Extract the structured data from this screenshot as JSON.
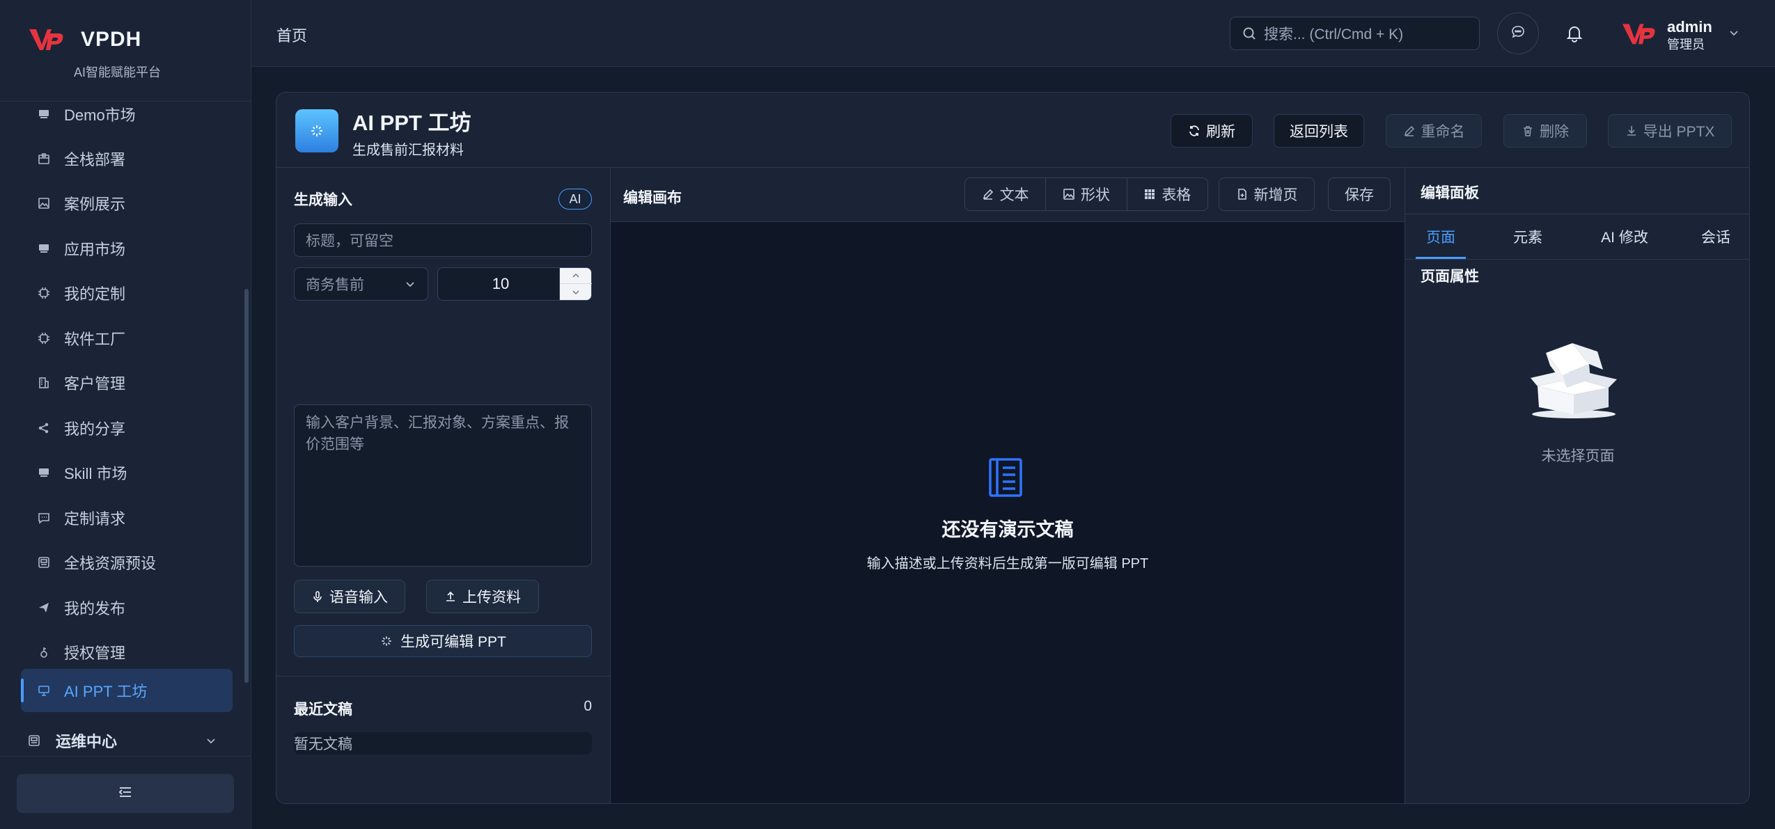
{
  "brand": {
    "name": "VPDH",
    "subtitle": "AI智能赋能平台"
  },
  "sidebar": {
    "items": [
      {
        "label": "Demo市场",
        "icon": "store-icon"
      },
      {
        "label": "全栈部署",
        "icon": "package-icon"
      },
      {
        "label": "案例展示",
        "icon": "image-icon"
      },
      {
        "label": "应用市场",
        "icon": "store-icon"
      },
      {
        "label": "我的定制",
        "icon": "chip-icon"
      },
      {
        "label": "软件工厂",
        "icon": "chip-icon"
      },
      {
        "label": "客户管理",
        "icon": "building-icon"
      },
      {
        "label": "我的分享",
        "icon": "share-icon"
      },
      {
        "label": "Skill 市场",
        "icon": "store-icon"
      },
      {
        "label": "定制请求",
        "icon": "message-icon"
      },
      {
        "label": "全栈资源预设",
        "icon": "preset-icon"
      },
      {
        "label": "我的发布",
        "icon": "send-icon"
      },
      {
        "label": "授权管理",
        "icon": "key-icon"
      },
      {
        "label": "AI PPT 工坊",
        "icon": "presentation-icon",
        "active": true
      }
    ],
    "group": {
      "label": "运维中心",
      "icon": "ops-icon"
    }
  },
  "header": {
    "breadcrumb": "首页",
    "search_placeholder": "搜索... (Ctrl/Cmd + K)",
    "user": {
      "name": "admin",
      "role": "管理员"
    }
  },
  "card": {
    "title": "AI PPT 工坊",
    "subtitle": "生成售前汇报材料",
    "buttons": {
      "refresh": "刷新",
      "back": "返回列表",
      "rename": "重命名",
      "delete": "删除",
      "export": "导出 PPTX"
    }
  },
  "input_panel": {
    "title": "生成输入",
    "badge": "AI",
    "title_placeholder": "标题，可留空",
    "scene_value": "商务售前",
    "page_count": "10",
    "description_placeholder": "输入客户背景、汇报对象、方案重点、报价范围等",
    "voice_button": "语音输入",
    "upload_button": "上传资料",
    "generate_button": "生成可编辑 PPT",
    "recent_title": "最近文稿",
    "recent_count": "0",
    "recent_empty": "暂无文稿"
  },
  "canvas": {
    "title": "编辑画布",
    "tools": {
      "text": "文本",
      "shape": "形状",
      "table": "表格",
      "add_page": "新增页",
      "save": "保存"
    },
    "empty_title": "还没有演示文稿",
    "empty_desc": "输入描述或上传资料后生成第一版可编辑 PPT"
  },
  "edit_panel": {
    "title": "编辑面板",
    "tabs": [
      "页面",
      "元素",
      "AI 修改",
      "会话"
    ],
    "active_tab": "页面",
    "section": "页面属性",
    "empty": "未选择页面"
  },
  "colors": {
    "accent": "#4a9cff",
    "brand_red": "#e5343f",
    "background": "#131c2b"
  }
}
